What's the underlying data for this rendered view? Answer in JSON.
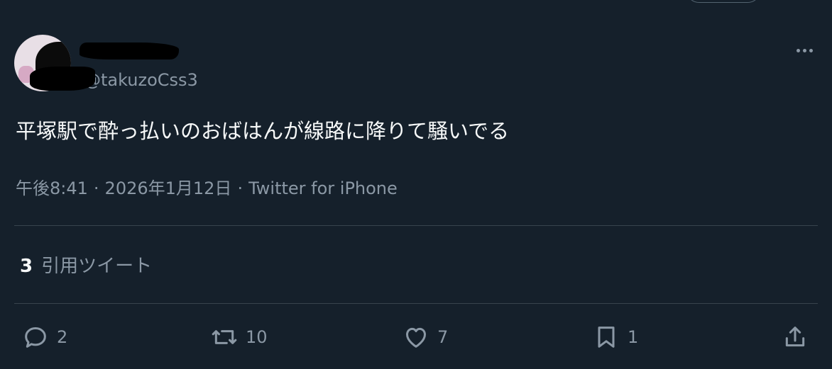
{
  "author": {
    "display_name": "",
    "handle": "@takuzoCss3"
  },
  "tweet": {
    "text": "平塚駅で酔っ払いのおばはんが線路に降りて騒いでる",
    "time": "午後8:41",
    "date": "2026年1月12日",
    "source": "Twitter for iPhone",
    "separator": "·"
  },
  "quote_tweets": {
    "count": "3",
    "label": "引用ツイート"
  },
  "actions": {
    "reply": {
      "icon": "reply-icon",
      "count": "2"
    },
    "retweet": {
      "icon": "retweet-icon",
      "count": "10"
    },
    "like": {
      "icon": "heart-icon",
      "count": "7"
    },
    "bookmark": {
      "icon": "bookmark-icon",
      "count": "1"
    },
    "share": {
      "icon": "share-icon"
    }
  },
  "colors": {
    "background": "#15202b",
    "text": "#f7f9f9",
    "secondary_text": "#8b98a5",
    "divider": "#38444d"
  }
}
